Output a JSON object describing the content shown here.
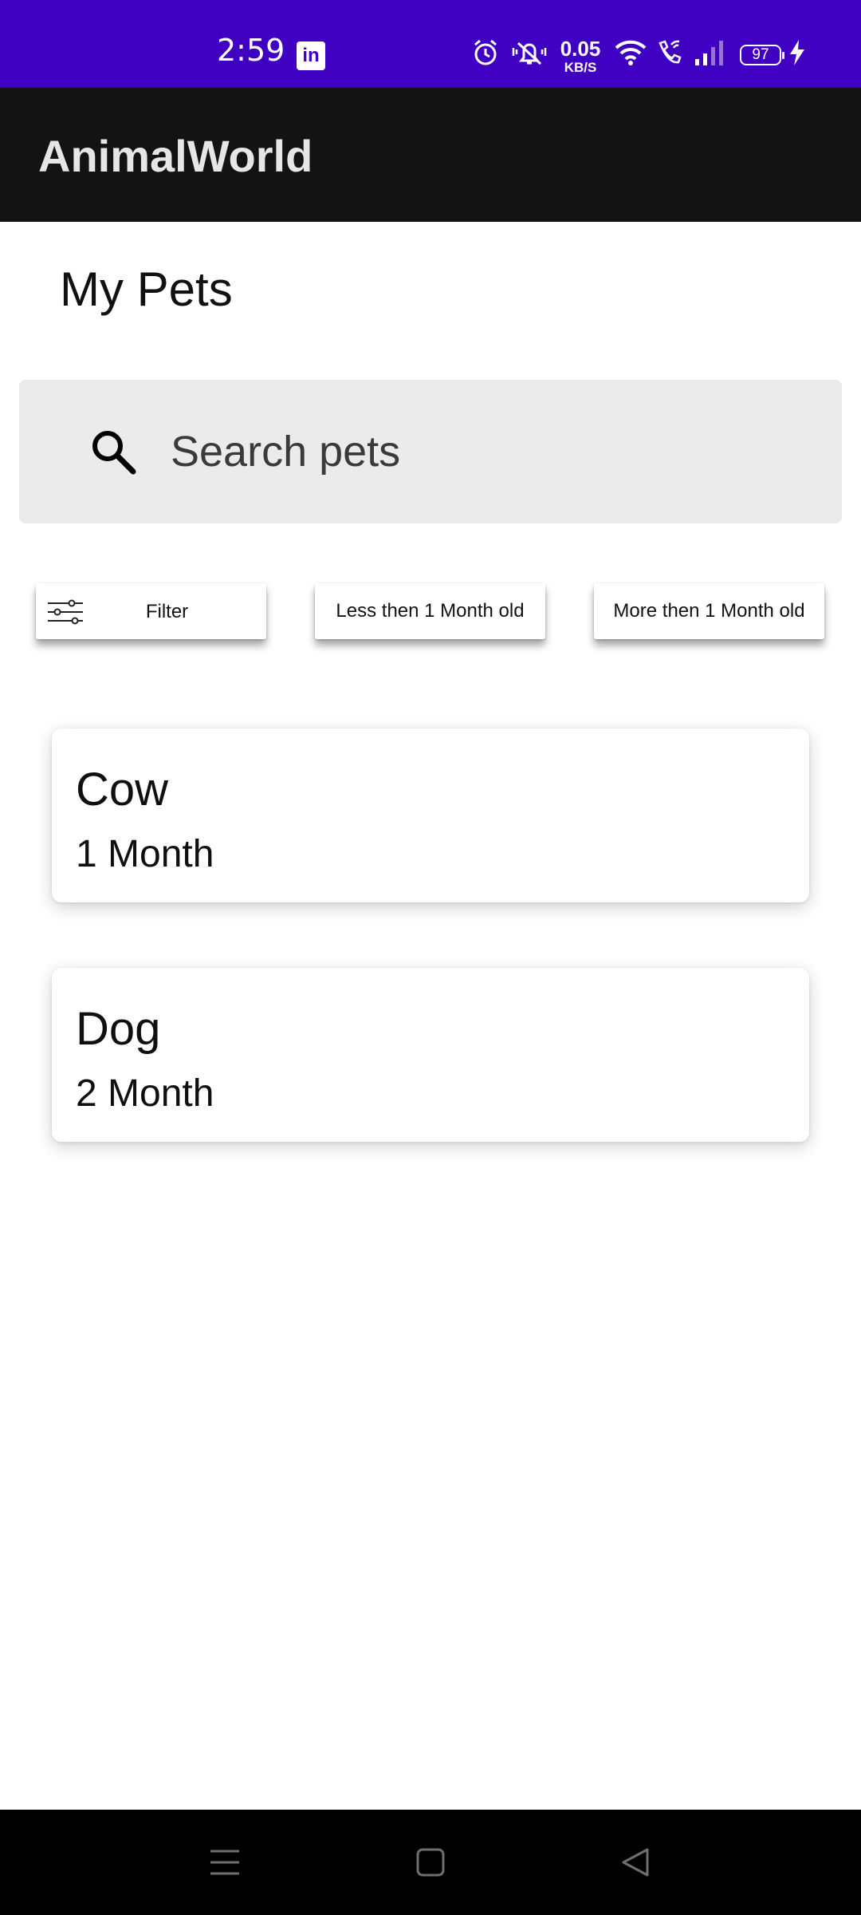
{
  "status_bar": {
    "time": "2:59",
    "net_speed_value": "0.05",
    "net_speed_unit": "KB/S",
    "battery": "97"
  },
  "app_bar": {
    "title": "AnimalWorld"
  },
  "page": {
    "title": "My Pets"
  },
  "search": {
    "placeholder": "Search pets",
    "value": ""
  },
  "filters": {
    "filter_label": "Filter",
    "less_label": "Less then 1 Month old",
    "more_label": "More then 1 Month old"
  },
  "pets": [
    {
      "name": "Cow",
      "age": "1 Month"
    },
    {
      "name": "Dog",
      "age": "2 Month"
    }
  ],
  "colors": {
    "status_bar": "#3f00c2",
    "app_bar": "#131313",
    "search_bg": "#ebebeb",
    "nav_bar": "#000000"
  },
  "icons": [
    "linkedin-icon",
    "alarm-icon",
    "mute-icon",
    "wifi-icon",
    "wifi-call-icon",
    "signal-icon",
    "battery-icon",
    "charging-icon",
    "search-icon",
    "filter-sliders-icon",
    "menu-icon",
    "home-icon",
    "back-icon"
  ]
}
